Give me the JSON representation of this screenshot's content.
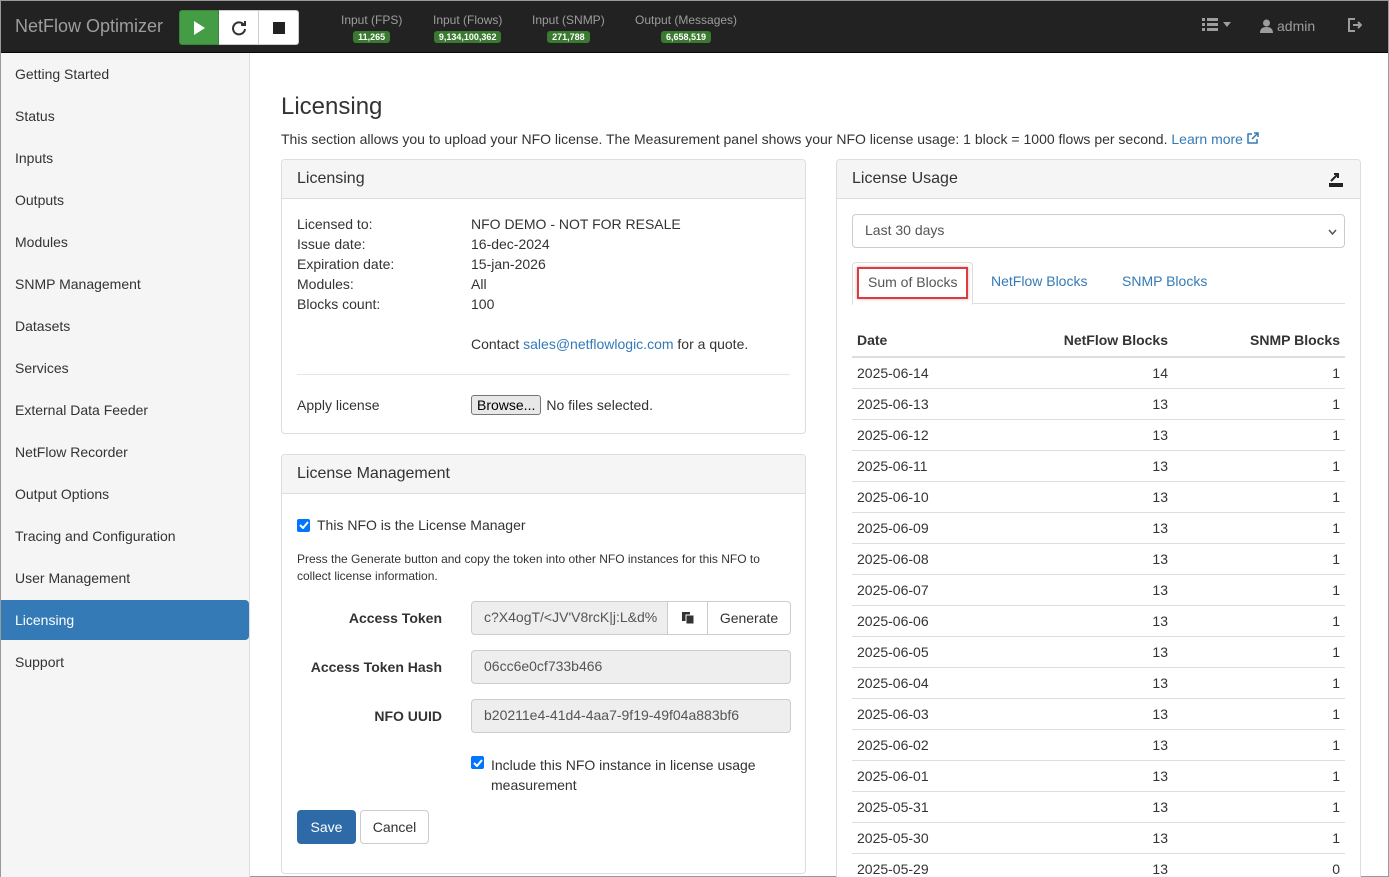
{
  "app": {
    "brand": "NetFlow Optimizer"
  },
  "stats": [
    {
      "label": "Input (FPS)",
      "value": "11,265"
    },
    {
      "label": "Input (Flows)",
      "value": "9,134,100,362"
    },
    {
      "label": "Input (SNMP)",
      "value": "271,788"
    },
    {
      "label": "Output (Messages)",
      "value": "6,658,519"
    }
  ],
  "user": {
    "name": "admin"
  },
  "sidebar": {
    "items": [
      {
        "label": "Getting Started"
      },
      {
        "label": "Status"
      },
      {
        "label": "Inputs"
      },
      {
        "label": "Outputs"
      },
      {
        "label": "Modules"
      },
      {
        "label": "SNMP Management"
      },
      {
        "label": "Datasets"
      },
      {
        "label": "Services"
      },
      {
        "label": "External Data Feeder"
      },
      {
        "label": "NetFlow Recorder"
      },
      {
        "label": "Output Options"
      },
      {
        "label": "Tracing and Configuration"
      },
      {
        "label": "User Management"
      },
      {
        "label": "Licensing"
      },
      {
        "label": "Support"
      }
    ]
  },
  "page": {
    "title": "Licensing",
    "intro": "This section allows you to upload your NFO license. The Measurement panel shows your NFO license usage: 1 block = 1000 flows per second.",
    "learn_more": "Learn more"
  },
  "licensing": {
    "heading": "Licensing",
    "licensed_to_label": "Licensed to:",
    "licensed_to": "NFO DEMO - NOT FOR RESALE",
    "issue_date_label": "Issue date:",
    "issue_date": "16-dec-2024",
    "expiration_label": "Expiration date:",
    "expiration": "15-jan-2026",
    "modules_label": "Modules:",
    "modules": "All",
    "blocks_label": "Blocks count:",
    "blocks": "100",
    "contact_prefix": "Contact",
    "contact_email": "sales@netflowlogic.com",
    "contact_suffix": "for a quote.",
    "apply_label": "Apply license",
    "browse_button": "Browse...",
    "file_status": "No files selected."
  },
  "management": {
    "heading": "License Management",
    "is_manager_label": "This NFO is the License Manager",
    "help_text": "Press the Generate button and copy the token into other NFO instances for this NFO to collect license information.",
    "token_label": "Access Token",
    "token_value": "c?X4ogT/<JV'V8rcK|j:L&d%",
    "generate_button": "Generate",
    "hash_label": "Access Token Hash",
    "hash_value": "06cc6e0cf733b466",
    "uuid_label": "NFO UUID",
    "uuid_value": "b20211e4-41d4-4aa7-9f19-49f04a883bf6",
    "include_label_1": "Include this NFO instance in license usage",
    "include_label_2": "measurement",
    "save_button": "Save",
    "cancel_button": "Cancel"
  },
  "usage": {
    "heading": "License Usage",
    "period_selected": "Last 30 days",
    "tabs": [
      "Sum of Blocks",
      "NetFlow Blocks",
      "SNMP Blocks"
    ],
    "columns": [
      "Date",
      "NetFlow Blocks",
      "SNMP Blocks"
    ],
    "rows": [
      [
        "2025-06-14",
        "14",
        "1"
      ],
      [
        "2025-06-13",
        "13",
        "1"
      ],
      [
        "2025-06-12",
        "13",
        "1"
      ],
      [
        "2025-06-11",
        "13",
        "1"
      ],
      [
        "2025-06-10",
        "13",
        "1"
      ],
      [
        "2025-06-09",
        "13",
        "1"
      ],
      [
        "2025-06-08",
        "13",
        "1"
      ],
      [
        "2025-06-07",
        "13",
        "1"
      ],
      [
        "2025-06-06",
        "13",
        "1"
      ],
      [
        "2025-06-05",
        "13",
        "1"
      ],
      [
        "2025-06-04",
        "13",
        "1"
      ],
      [
        "2025-06-03",
        "13",
        "1"
      ],
      [
        "2025-06-02",
        "13",
        "1"
      ],
      [
        "2025-06-01",
        "13",
        "1"
      ],
      [
        "2025-05-31",
        "13",
        "1"
      ],
      [
        "2025-05-30",
        "13",
        "1"
      ],
      [
        "2025-05-29",
        "13",
        "0"
      ]
    ]
  }
}
